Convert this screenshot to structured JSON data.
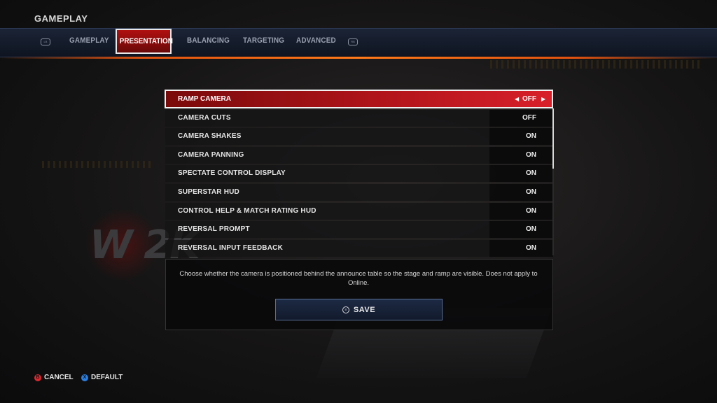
{
  "header": {
    "title": "GAMEPLAY"
  },
  "tabs": {
    "left_bumper": "LB",
    "right_bumper": "RB",
    "items": [
      {
        "label": "GAMEPLAY"
      },
      {
        "label": "PRESENTATION",
        "active": true
      },
      {
        "label": "BALANCING"
      },
      {
        "label": "TARGETING"
      },
      {
        "label": "ADVANCED"
      }
    ]
  },
  "settings": [
    {
      "label": "RAMP CAMERA",
      "value": "OFF",
      "selected": true
    },
    {
      "label": "CAMERA CUTS",
      "value": "OFF"
    },
    {
      "label": "CAMERA SHAKES",
      "value": "ON"
    },
    {
      "label": "CAMERA PANNING",
      "value": "ON"
    },
    {
      "label": "SPECTATE CONTROL DISPLAY",
      "value": "ON"
    },
    {
      "label": "SUPERSTAR HUD",
      "value": "ON"
    },
    {
      "label": "CONTROL HELP & MATCH RATING HUD",
      "value": "ON"
    },
    {
      "label": "REVERSAL PROMPT",
      "value": "ON"
    },
    {
      "label": "REVERSAL INPUT FEEDBACK",
      "value": "ON"
    }
  ],
  "description": "Choose whether the camera is positioned behind the announce table so the stage and ramp are visible. Does not apply to Online.",
  "save": {
    "label": "SAVE",
    "icon": "menu-button-icon"
  },
  "footer": {
    "cancel": {
      "label": "CANCEL",
      "glyph": "B",
      "color": "#e0262d"
    },
    "default": {
      "label": "DEFAULT",
      "glyph": "X",
      "color": "#2a7fe0"
    }
  },
  "background": {
    "logo_text": "W 2K"
  },
  "colors": {
    "accent_red": "#b0141a",
    "tab_glow": "#ff7a1a",
    "save_border": "#5a6f96"
  }
}
